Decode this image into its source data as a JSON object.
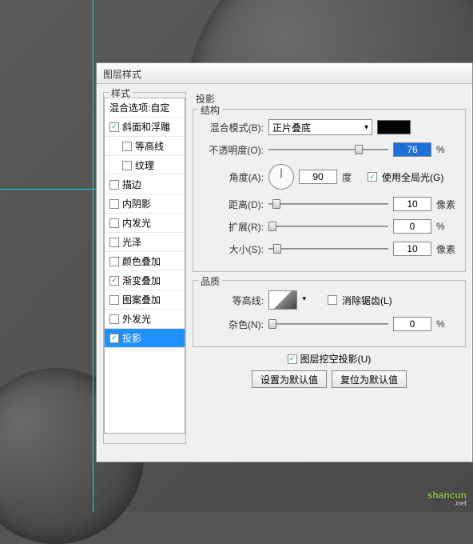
{
  "dialog": {
    "title": "图层样式"
  },
  "styles_panel": {
    "title": "样式",
    "blend_options": "混合选项:自定",
    "items": [
      {
        "label": "斜面和浮雕",
        "checked": true,
        "indent": false
      },
      {
        "label": "等高线",
        "checked": false,
        "indent": true
      },
      {
        "label": "纹理",
        "checked": false,
        "indent": true
      },
      {
        "label": "描边",
        "checked": false,
        "indent": false
      },
      {
        "label": "内阴影",
        "checked": false,
        "indent": false
      },
      {
        "label": "内发光",
        "checked": false,
        "indent": false
      },
      {
        "label": "光泽",
        "checked": false,
        "indent": false
      },
      {
        "label": "颜色叠加",
        "checked": false,
        "indent": false
      },
      {
        "label": "渐变叠加",
        "checked": true,
        "indent": false
      },
      {
        "label": "图案叠加",
        "checked": false,
        "indent": false
      },
      {
        "label": "外发光",
        "checked": false,
        "indent": false
      },
      {
        "label": "投影",
        "checked": true,
        "indent": false,
        "selected": true
      }
    ]
  },
  "section": {
    "title": "投影",
    "structure": {
      "title": "结构",
      "blend_mode_label": "混合模式(B):",
      "blend_mode_value": "正片叠底",
      "opacity_label": "不透明度(O):",
      "opacity_value": "76",
      "opacity_unit": "%",
      "angle_label": "角度(A):",
      "angle_value": "90",
      "angle_unit": "度",
      "global_light_label": "使用全局光(G)",
      "global_light_checked": true,
      "distance_label": "距离(D):",
      "distance_value": "10",
      "distance_unit": "像素",
      "spread_label": "扩展(R):",
      "spread_value": "0",
      "spread_unit": "%",
      "size_label": "大小(S):",
      "size_value": "10",
      "size_unit": "像素"
    },
    "quality": {
      "title": "品质",
      "contour_label": "等高线:",
      "antialias_label": "消除锯齿(L)",
      "antialias_checked": false,
      "noise_label": "杂色(N):",
      "noise_value": "0",
      "noise_unit": "%"
    },
    "knockout_label": "图层挖空投影(U)",
    "knockout_checked": true,
    "set_default_btn": "设置为默认值",
    "reset_default_btn": "复位为默认值"
  },
  "watermark": "shancun"
}
